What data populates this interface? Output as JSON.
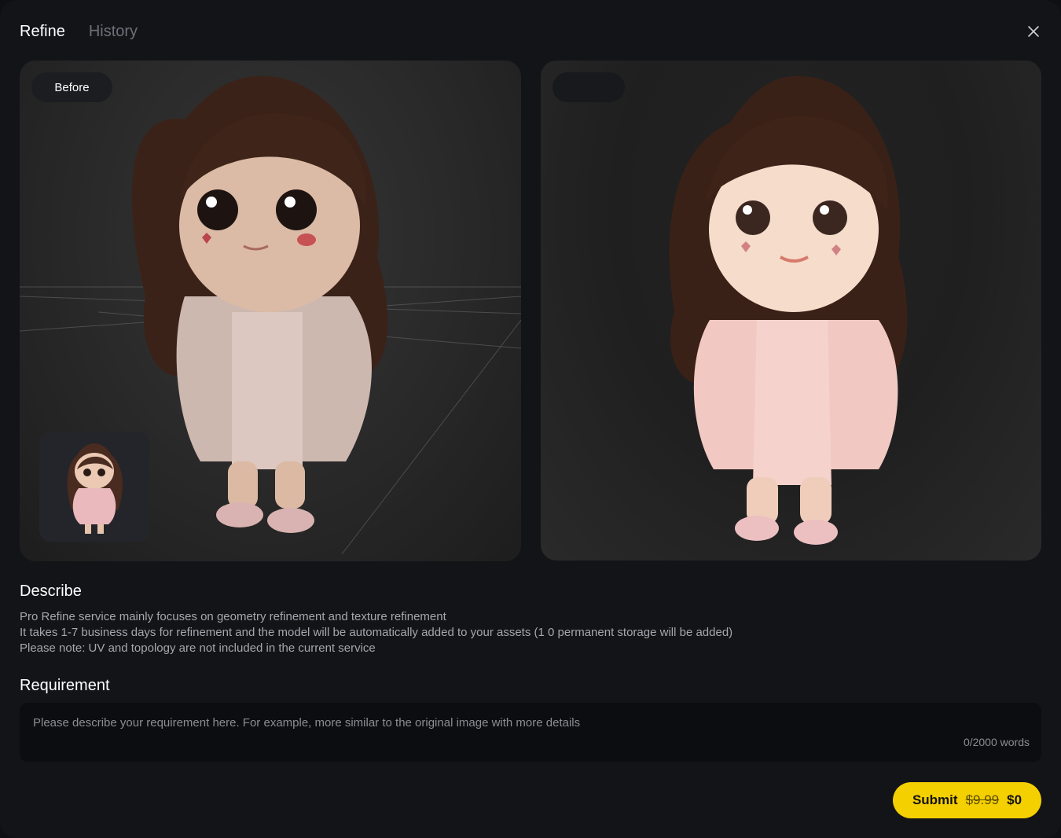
{
  "tabs": [
    {
      "label": "Refine",
      "active": true
    },
    {
      "label": "History",
      "active": false
    }
  ],
  "close_icon": "close-icon",
  "before_panel": {
    "label": "Before",
    "thumbnail_icon": "reference-image-thumbnail"
  },
  "after_panel": {
    "label": ""
  },
  "describe": {
    "title": "Describe",
    "lines": [
      "Pro Refine service mainly focuses on geometry refinement and texture refinement",
      "It takes 1-7 business days for refinement and the model will be automatically added to your assets (1 0 permanent storage will be added)",
      "Please note: UV and topology are not included in the current service"
    ]
  },
  "requirement": {
    "title": "Requirement",
    "placeholder": "Please describe your requirement here. For example, more similar to the original image with more details",
    "value": "",
    "counter": "0/2000 words"
  },
  "submit": {
    "label": "Submit",
    "old_price": "$9.99",
    "price": "$0"
  },
  "colors": {
    "accent": "#f5d000",
    "background": "#131418"
  }
}
